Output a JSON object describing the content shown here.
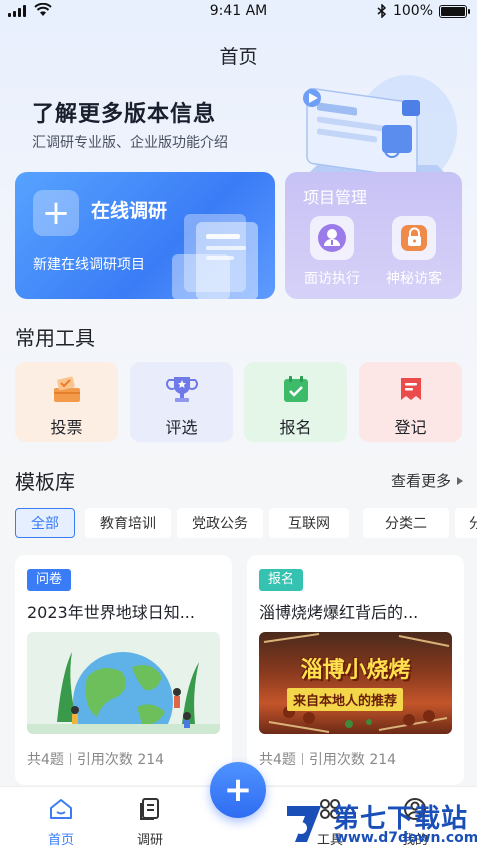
{
  "status_bar": {
    "time": "9:41 AM",
    "battery": "100%",
    "battery_level": 1.0
  },
  "header": {
    "title": "首页"
  },
  "hero": {
    "title": "了解更多版本信息",
    "subtitle": "汇调研专业版、企业版功能介绍"
  },
  "online_survey": {
    "title": "在线调研",
    "description": "新建在线调研项目",
    "icon": "plus-icon"
  },
  "project_mgmt": {
    "title": "项目管理",
    "items": [
      {
        "label": "面访执行",
        "icon": "person-icon"
      },
      {
        "label": "神秘访客",
        "icon": "lock-bag-icon"
      }
    ]
  },
  "tools": {
    "title": "常用工具",
    "items": [
      {
        "label": "投票",
        "icon": "ballot-box-icon",
        "bg": "#fdeee3"
      },
      {
        "label": "评选",
        "icon": "trophy-icon",
        "bg": "#e9ecfb"
      },
      {
        "label": "报名",
        "icon": "calendar-check-icon",
        "bg": "#e3f6e8"
      },
      {
        "label": "登记",
        "icon": "register-icon",
        "bg": "#fde6e6"
      }
    ]
  },
  "templates": {
    "title": "模板库",
    "more": "查看更多",
    "filters": [
      "全部",
      "教育培训",
      "党政公务",
      "互联网",
      "分类二",
      "分"
    ],
    "cards": [
      {
        "tag": "问卷",
        "tag_color": "#3a7cf6",
        "title": "2023年世界地球日知...",
        "questions": "共4题",
        "usage": "引用次数 214"
      },
      {
        "tag": "报名",
        "tag_color": "#35c2b0",
        "title": "淄博烧烤爆红背后的...",
        "questions": "共4题",
        "usage": "引用次数 214",
        "image_text_1": "淄博小烧烤",
        "image_text_2": "来自本地人的推荐"
      }
    ]
  },
  "tabbar": {
    "items": [
      {
        "label": "首页",
        "icon": "home-icon"
      },
      {
        "label": "调研",
        "icon": "document-icon"
      },
      {
        "label": "工具",
        "icon": "grid-icon"
      },
      {
        "label": "我的",
        "icon": "user-icon"
      }
    ],
    "fab_icon": "plus-icon"
  },
  "watermark": {
    "brand": "第七下载站",
    "url": "www.d7down.com"
  }
}
